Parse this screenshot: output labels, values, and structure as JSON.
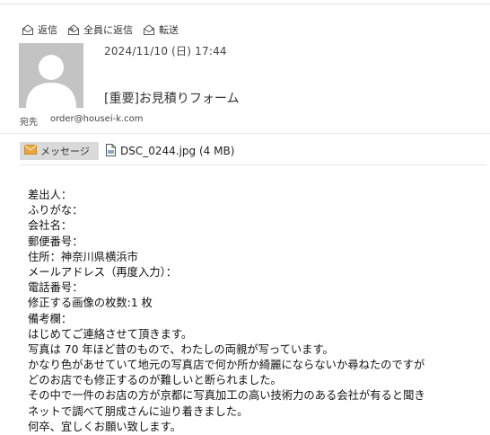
{
  "toolbar": {
    "reply_label": "返信",
    "reply_all_label": "全員に返信",
    "forward_label": "転送"
  },
  "message": {
    "date": "2024/11/10 (日) 17:44",
    "subject": "[重要]お見積りフォーム",
    "to_label": "宛先",
    "to_address": "order@housei-k.com"
  },
  "attachments": {
    "message_tab_label": "メッセージ",
    "file_label": "DSC_0244.jpg (4 MB)"
  },
  "body_lines": [
    "差出人：",
    "ふりがな：",
    "会社名：",
    "郵便番号：",
    "住所：神奈川県横浜市",
    "メールアドレス（再度入力）：",
    "電話番号：",
    "修正する画像の枚数:1 枚",
    "備考欄：",
    "はじめてご連絡させて頂きます。",
    "写真は 70 年ほど昔のもので、わたしの両親が写っています。",
    "かなり色があせていて地元の写真店で何か所か綺麗にならないか尋ねたのですが",
    "どのお店でも修正するのが難しいと断られました。",
    "その中で一件のお店の方が京都に写真加工の高い技術力のある会社が有ると聞き",
    "ネットで調べて朋成さんに辿り着きました。",
    "何卒、宜しくお願い致します。"
  ],
  "colors": {
    "avatar_bg": "#c3c3c3",
    "message_tab_bg": "#dadada",
    "envelope_icon": "#e8a640"
  }
}
